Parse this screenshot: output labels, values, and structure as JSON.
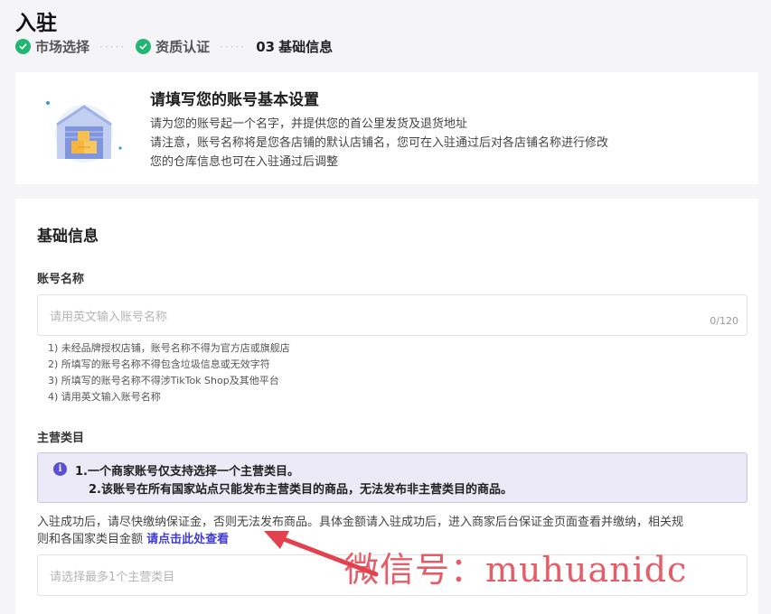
{
  "page": {
    "title": "入驻"
  },
  "steps": [
    {
      "label": "市场选择",
      "status": "done"
    },
    {
      "label": "资质认证",
      "status": "done"
    },
    {
      "num": "03",
      "label": "基础信息",
      "status": "current"
    }
  ],
  "step_separator": "·····",
  "intro": {
    "title": "请填写您的账号基本设置",
    "lines": [
      "请为您的账号起一个名字，并提供您的首公里发货及退货地址",
      "请注意，账号名称将是您各店铺的默认店铺名，您可在入驻通过后对各店铺名称进行修改",
      "您的仓库信息也可在入驻通过后调整"
    ]
  },
  "form": {
    "section_title": "基础信息",
    "account_name": {
      "label": "账号名称",
      "placeholder": "请用英文输入账号名称",
      "counter": "0/120",
      "rules": [
        "1) 未经品牌授权店铺，账号名称不得为官方店或旗舰店",
        "2) 所填写的账号名称不得包含垃圾信息或无效字符",
        "3) 所填写的账号名称不得涉TikTok Shop及其他平台",
        "4) 请用英文输入账号名称"
      ]
    },
    "main_category": {
      "label": "主营类目",
      "notice_lines": [
        "1.一个商家账号仅支持选择一个主营类目。",
        "2.该账号在所有国家站点只能发布主营类目的商品，无法发布非主营类目的商品。"
      ],
      "paragraph_line1": "入驻成功后，请尽快缴纳保证金，否则无法发布商品。具体金额请入驻成功后，进入商家后台保证金页面查看并缴纳，相关规",
      "paragraph_line2": "则和各国家类目金额",
      "link_text": "请点击此处查看",
      "placeholder": "请选择最多1个主营类目"
    }
  },
  "watermark": "微信号：muhuanidc",
  "colors": {
    "accent": "#3f3bd4",
    "success": "#22b573",
    "watermark": "#e2414e"
  }
}
